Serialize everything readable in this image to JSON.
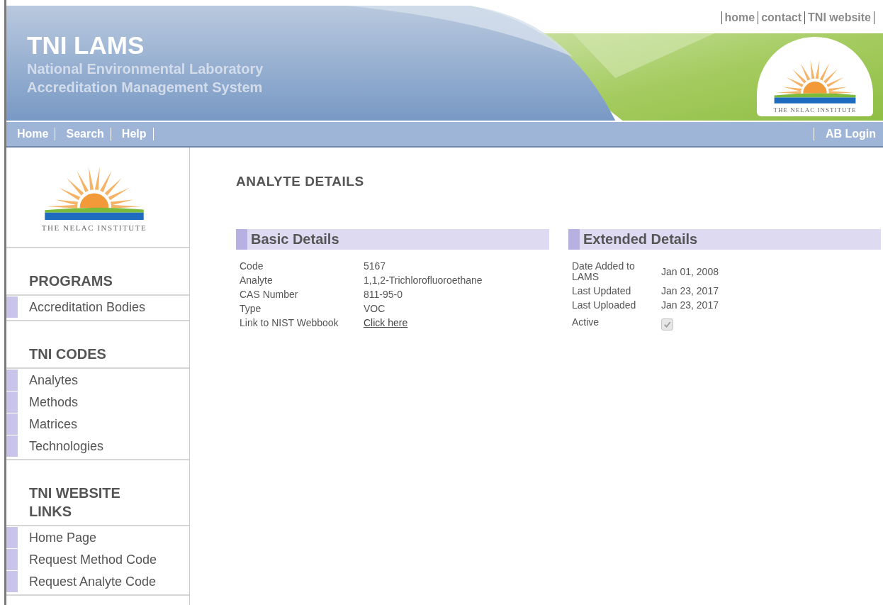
{
  "header": {
    "title": "TNI LAMS",
    "subtitle_lines": [
      "National Environmental Laboratory",
      "Accreditation Management System"
    ],
    "top_links": [
      "home",
      "contact",
      "TNI website"
    ],
    "logo_caption": "THE NELAC INSTITUTE"
  },
  "nav": {
    "left": [
      "Home",
      "Search",
      "Help"
    ],
    "right": [
      "AB Login"
    ]
  },
  "sidebar": {
    "logo_caption": "THE NELAC INSTITUTE",
    "sections": [
      {
        "heading": "PROGRAMS",
        "items": [
          "Accreditation Bodies"
        ]
      },
      {
        "heading": "TNI CODES",
        "items": [
          "Analytes",
          "Methods",
          "Matrices",
          "Technologies"
        ]
      },
      {
        "heading": "TNI WEBSITE LINKS",
        "items": [
          "Home Page",
          "Request Method Code",
          "Request Analyte Code"
        ]
      }
    ]
  },
  "main": {
    "heading": "ANALYTE DETAILS",
    "panels": [
      {
        "title": "Basic Details",
        "rows": [
          {
            "kind": "text",
            "label": "Code",
            "value": "5167"
          },
          {
            "kind": "text",
            "label": "Analyte",
            "value": "1,1,2-Trichlorofluoroethane"
          },
          {
            "kind": "text",
            "label": "CAS Number",
            "value": "811-95-0"
          },
          {
            "kind": "text",
            "label": "Type",
            "value": "VOC"
          },
          {
            "kind": "link",
            "label": "Link to NIST Webbook",
            "value": "Click here"
          }
        ]
      },
      {
        "title": "Extended Details",
        "rows": [
          {
            "kind": "text",
            "label": "Date Added to LAMS",
            "value": "Jan 01, 2008"
          },
          {
            "kind": "text",
            "label": "Last Updated",
            "value": "Jan 23, 2017"
          },
          {
            "kind": "text",
            "label": "Last Uploaded",
            "value": "Jan 23, 2017"
          },
          {
            "kind": "checkbox",
            "label": "Active",
            "checked": true,
            "disabled": true
          }
        ]
      }
    ]
  }
}
